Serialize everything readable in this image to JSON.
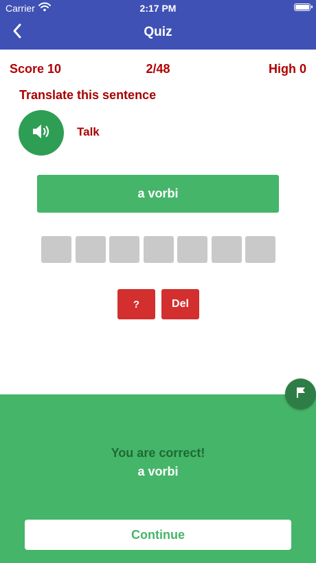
{
  "status_bar": {
    "carrier": "Carrier",
    "wifi_icon": "wifi-icon",
    "time": "2:17 PM",
    "battery_icon": "battery-icon"
  },
  "nav": {
    "back_icon": "chevron-left-icon",
    "title": "Quiz"
  },
  "scores": {
    "score_label": "Score  10",
    "progress": "2/48",
    "high_label": "High  0"
  },
  "question": {
    "prompt": "Translate this sentence",
    "speaker_icon": "speaker-icon",
    "talk_label": "Talk",
    "answer_text": "a vorbi",
    "slot_count": 7
  },
  "buttons": {
    "hint": "?",
    "delete": "Del"
  },
  "result": {
    "message": "You are correct!",
    "answer": "a vorbi",
    "continue": "Continue",
    "flag_icon": "flag-icon"
  },
  "colors": {
    "nav_bar": "#3f51b5",
    "accent_green": "#45b569",
    "dark_green": "#2e9e55",
    "red_text": "#b00000",
    "red_button": "#d32f2f",
    "slot_gray": "#c9c9c9"
  }
}
